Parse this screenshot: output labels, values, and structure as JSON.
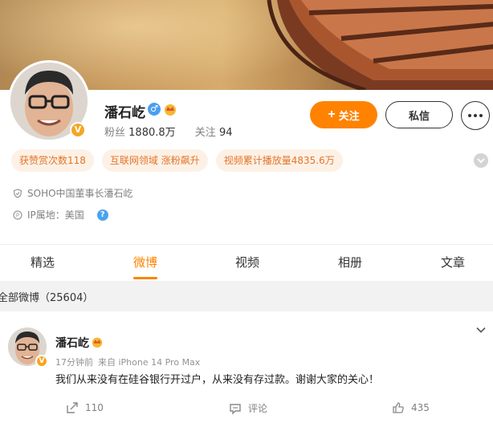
{
  "profile": {
    "name": "潘石屹",
    "verified_badge": "V",
    "fans_label": "粉丝",
    "fans_count": "1880.8万",
    "following_label": "关注",
    "following_count": "94",
    "follow_button": "关注",
    "message_button": "私信",
    "tags": [
      "获赞赏次数118",
      "互联网领域 涨粉飙升",
      "视频累计播放量4835.6万"
    ],
    "bio": "SOHO中国董事长潘石屹",
    "ip_location": "IP属地：美国",
    "help_glyph": "?"
  },
  "tabs": [
    {
      "label": "精选",
      "active": false
    },
    {
      "label": "微博",
      "active": true
    },
    {
      "label": "视频",
      "active": false
    },
    {
      "label": "相册",
      "active": false
    },
    {
      "label": "文章",
      "active": false
    }
  ],
  "section": {
    "title": "全部微博（25604）"
  },
  "post": {
    "author": "潘石屹",
    "time": "17分钟前",
    "source": "来自 iPhone 14 Pro Max",
    "text": "我们从来没有在硅谷银行开过户，从来没有存过款。谢谢大家的关心！",
    "repost_count": "110",
    "comment_label": "评论",
    "like_count": "435"
  },
  "colors": {
    "accent": "#ff8200",
    "tag_bg": "#fdf1e6",
    "tag_text": "#e3752a"
  }
}
